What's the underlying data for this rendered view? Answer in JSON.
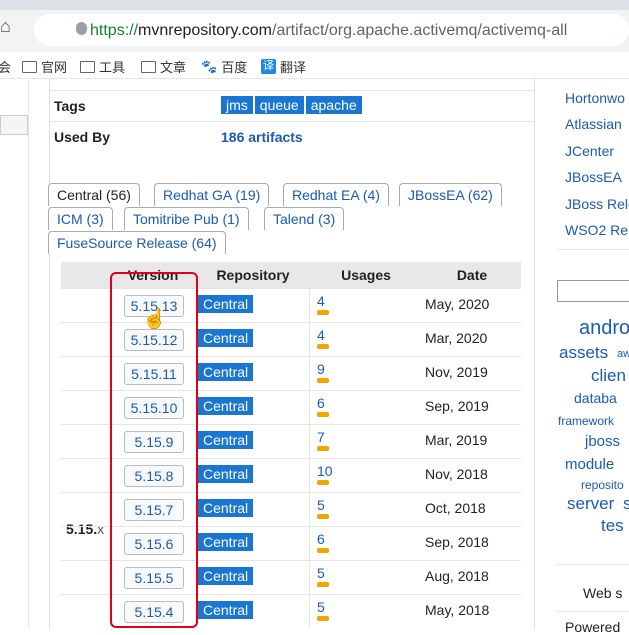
{
  "browser": {
    "url_scheme": "https://",
    "url_host": "mvnrepository.com",
    "url_path": "/artifact/org.apache.activemq/activemq-all"
  },
  "bookmarks": [
    {
      "label": "会",
      "icon": "partial-icon"
    },
    {
      "label": "官网",
      "icon": "folder-icon"
    },
    {
      "label": "工具",
      "icon": "folder-icon"
    },
    {
      "label": "文章",
      "icon": "folder-icon"
    },
    {
      "label": "百度",
      "icon": "baidu-paw-icon"
    },
    {
      "label": "翻译",
      "icon": "translate-icon"
    }
  ],
  "info": {
    "tags_label": "Tags",
    "tags": [
      "jms",
      "queue",
      "apache"
    ],
    "used_by_label": "Used By",
    "used_by_value": "186 artifacts"
  },
  "repo_tabs": [
    "Central (56)",
    "Redhat GA (19)",
    "Redhat EA (4)",
    "JBossEA (62)",
    "ICM (3)",
    "Tomitribe Pub (1)",
    "Talend (3)",
    "FuseSource Release (64)"
  ],
  "versions_table": {
    "headers": {
      "version": "Version",
      "repository": "Repository",
      "usages": "Usages",
      "date": "Date"
    },
    "group_label": "5.15.",
    "group_suffix": "x",
    "rows": [
      {
        "version": "5.15.13",
        "repo": "Central",
        "usages": "4",
        "date": "May, 2020"
      },
      {
        "version": "5.15.12",
        "repo": "Central",
        "usages": "4",
        "date": "Mar, 2020"
      },
      {
        "version": "5.15.11",
        "repo": "Central",
        "usages": "9",
        "date": "Nov, 2019"
      },
      {
        "version": "5.15.10",
        "repo": "Central",
        "usages": "6",
        "date": "Sep, 2019"
      },
      {
        "version": "5.15.9",
        "repo": "Central",
        "usages": "7",
        "date": "Mar, 2019"
      },
      {
        "version": "5.15.8",
        "repo": "Central",
        "usages": "10",
        "date": "Nov, 2018"
      },
      {
        "version": "5.15.7",
        "repo": "Central",
        "usages": "5",
        "date": "Oct, 2018"
      },
      {
        "version": "5.15.6",
        "repo": "Central",
        "usages": "6",
        "date": "Sep, 2018"
      },
      {
        "version": "5.15.5",
        "repo": "Central",
        "usages": "5",
        "date": "Aug, 2018"
      },
      {
        "version": "5.15.4",
        "repo": "Central",
        "usages": "5",
        "date": "May, 2018"
      }
    ]
  },
  "sidebar": {
    "repo_links": [
      "Hortonwo",
      "Atlassian",
      "JCenter",
      "JBossEA",
      "JBoss Rele",
      "WSO2 Rel"
    ],
    "tag_cloud": [
      "andro",
      "assets",
      "aw",
      "clien",
      "databa",
      "framework",
      "jboss",
      "module",
      "reposito",
      "server",
      "s",
      "tes"
    ],
    "footer_text_1": "Web s",
    "footer_text_2": "Powered"
  },
  "colors": {
    "accent_blue": "#1976d2",
    "link_blue": "#1a5bb3",
    "highlight_red": "#e0001a",
    "usage_bar": "#f0a500"
  }
}
